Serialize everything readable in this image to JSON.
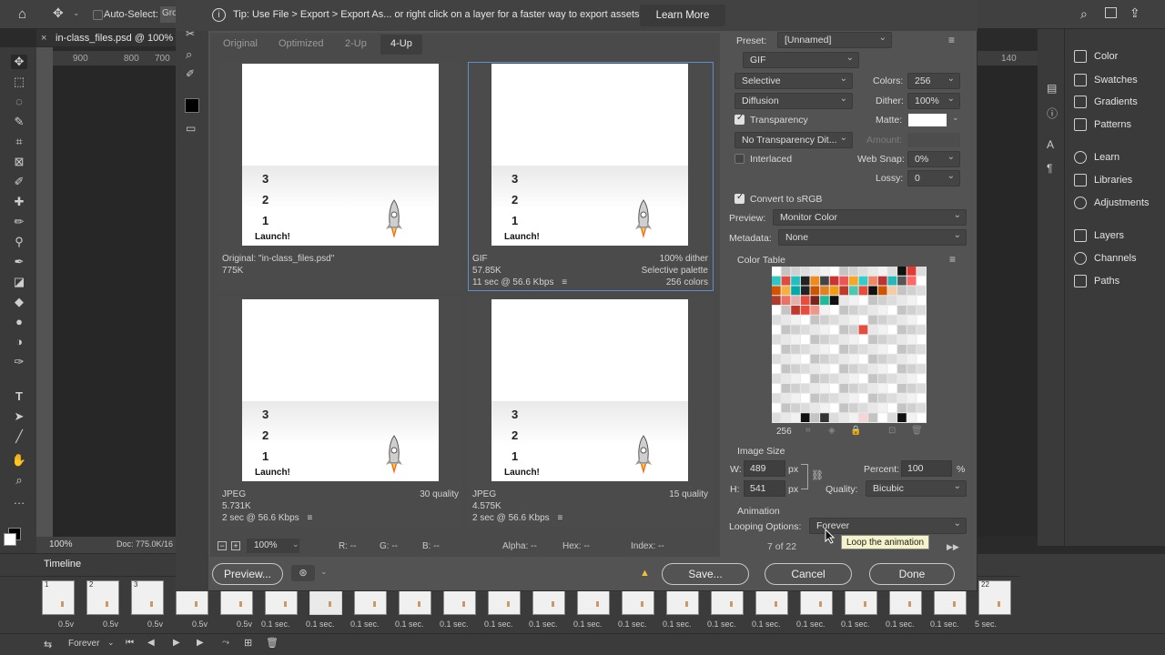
{
  "photoshop": {
    "auto_select_label": "Auto-Select:",
    "auto_select_value": "Gro",
    "doc_tab": "in-class_files.psd @ 100%",
    "ruler_ticks": [
      "900",
      "800",
      "700"
    ],
    "ruler_right": "140",
    "zoom": "100%",
    "doc_size": "Doc: 775.0K/16",
    "right_panels": [
      {
        "label": "Color",
        "icon": "color-icon"
      },
      {
        "label": "Swatches",
        "icon": "swatches-icon"
      },
      {
        "label": "Gradients",
        "icon": "gradients-icon"
      },
      {
        "label": "Patterns",
        "icon": "patterns-icon"
      },
      {
        "label": "Learn",
        "icon": "learn-icon"
      },
      {
        "label": "Libraries",
        "icon": "libraries-icon"
      },
      {
        "label": "Adjustments",
        "icon": "adjustments-icon"
      },
      {
        "label": "Layers",
        "icon": "layers-icon"
      },
      {
        "label": "Channels",
        "icon": "channels-icon"
      },
      {
        "label": "Paths",
        "icon": "paths-icon"
      }
    ],
    "timeline": {
      "title": "Timeline",
      "frames": [
        {
          "n": "1",
          "t": "0.5v"
        },
        {
          "n": "2",
          "t": "0.5v"
        },
        {
          "n": "3",
          "t": "0.5v"
        },
        {
          "n": "",
          "t": "0.5v"
        },
        {
          "n": "",
          "t": "0.5v"
        },
        {
          "n": "",
          "t": "0.1 sec."
        },
        {
          "n": "",
          "t": "0.1 sec."
        },
        {
          "n": "",
          "t": "0.1 sec."
        },
        {
          "n": "",
          "t": "0.1 sec."
        },
        {
          "n": "",
          "t": "0.1 sec."
        },
        {
          "n": "",
          "t": "0.1 sec."
        },
        {
          "n": "",
          "t": "0.1 sec."
        },
        {
          "n": "",
          "t": "0.1 sec."
        },
        {
          "n": "",
          "t": "0.1 sec."
        },
        {
          "n": "",
          "t": "0.1 sec."
        },
        {
          "n": "",
          "t": "0.1 sec."
        },
        {
          "n": "",
          "t": "0.1 sec."
        },
        {
          "n": "",
          "t": "0.1 sec."
        },
        {
          "n": "",
          "t": "0.1 sec."
        },
        {
          "n": "",
          "t": "0.1 sec."
        },
        {
          "n": "",
          "t": "0.1 sec."
        },
        {
          "n": "22",
          "t": "5 sec."
        }
      ],
      "loop": "Forever"
    }
  },
  "dialog": {
    "tip": "Tip: Use File > Export > Export As...  or right click on a layer for a faster way to export assets",
    "learn_more": "Learn More",
    "tabs": [
      "Original",
      "Optimized",
      "2-Up",
      "4-Up"
    ],
    "active_tab": "4-Up",
    "image_text": {
      "c3": "3",
      "c2": "2",
      "c1": "1",
      "launch": "Launch!"
    },
    "previews": [
      {
        "l1": "Original: \"in-class_files.psd\"",
        "l2": "775K",
        "l3": "",
        "r1": "",
        "r2": "",
        "r3": ""
      },
      {
        "l1": "GIF",
        "l2": "57.85K",
        "l3": "11 sec @ 56.6 Kbps",
        "r1": "100% dither",
        "r2": "Selective palette",
        "r3": "256 colors"
      },
      {
        "l1": "JPEG",
        "l2": "5.731K",
        "l3": "2 sec @ 56.6 Kbps",
        "r1": "30 quality",
        "r2": "",
        "r3": ""
      },
      {
        "l1": "JPEG",
        "l2": "4.575K",
        "l3": "2 sec @ 56.6 Kbps",
        "r1": "15 quality",
        "r2": "",
        "r3": ""
      }
    ],
    "bottom": {
      "zoom": "100%",
      "r": "R: --",
      "g": "G: --",
      "b": "B: --",
      "alpha": "Alpha: --",
      "hex": "Hex: --",
      "index": "Index: --",
      "preview_btn": "Preview...",
      "save_btn": "Save...",
      "cancel_btn": "Cancel",
      "done_btn": "Done"
    },
    "settings": {
      "preset_label": "Preset:",
      "preset_value": "[Unnamed]",
      "format": "GIF",
      "reduction": "Selective",
      "colors_label": "Colors:",
      "colors": "256",
      "dither_algo": "Diffusion",
      "dither_label": "Dither:",
      "dither": "100%",
      "transparency": "Transparency",
      "matte_label": "Matte:",
      "no_trans_dither": "No Transparency Dit...",
      "amount_label": "Amount:",
      "interlaced": "Interlaced",
      "websnap_label": "Web Snap:",
      "websnap": "0%",
      "lossy_label": "Lossy:",
      "lossy": "0",
      "convert_srgb": "Convert to sRGB",
      "preview_label": "Preview:",
      "preview_value": "Monitor Color",
      "metadata_label": "Metadata:",
      "metadata_value": "None",
      "color_table_title": "Color Table",
      "color_count": "256",
      "image_size_title": "Image Size",
      "w_label": "W:",
      "w": "489",
      "h_label": "H:",
      "h": "541",
      "px": "px",
      "percent_label": "Percent:",
      "percent": "100",
      "pct": "%",
      "quality_label": "Quality:",
      "quality": "Bicubic",
      "animation_title": "Animation",
      "looping_label": "Looping Options:",
      "looping": "Forever",
      "frame_counter": "7 of 22",
      "tooltip": "Loop the animation"
    }
  }
}
